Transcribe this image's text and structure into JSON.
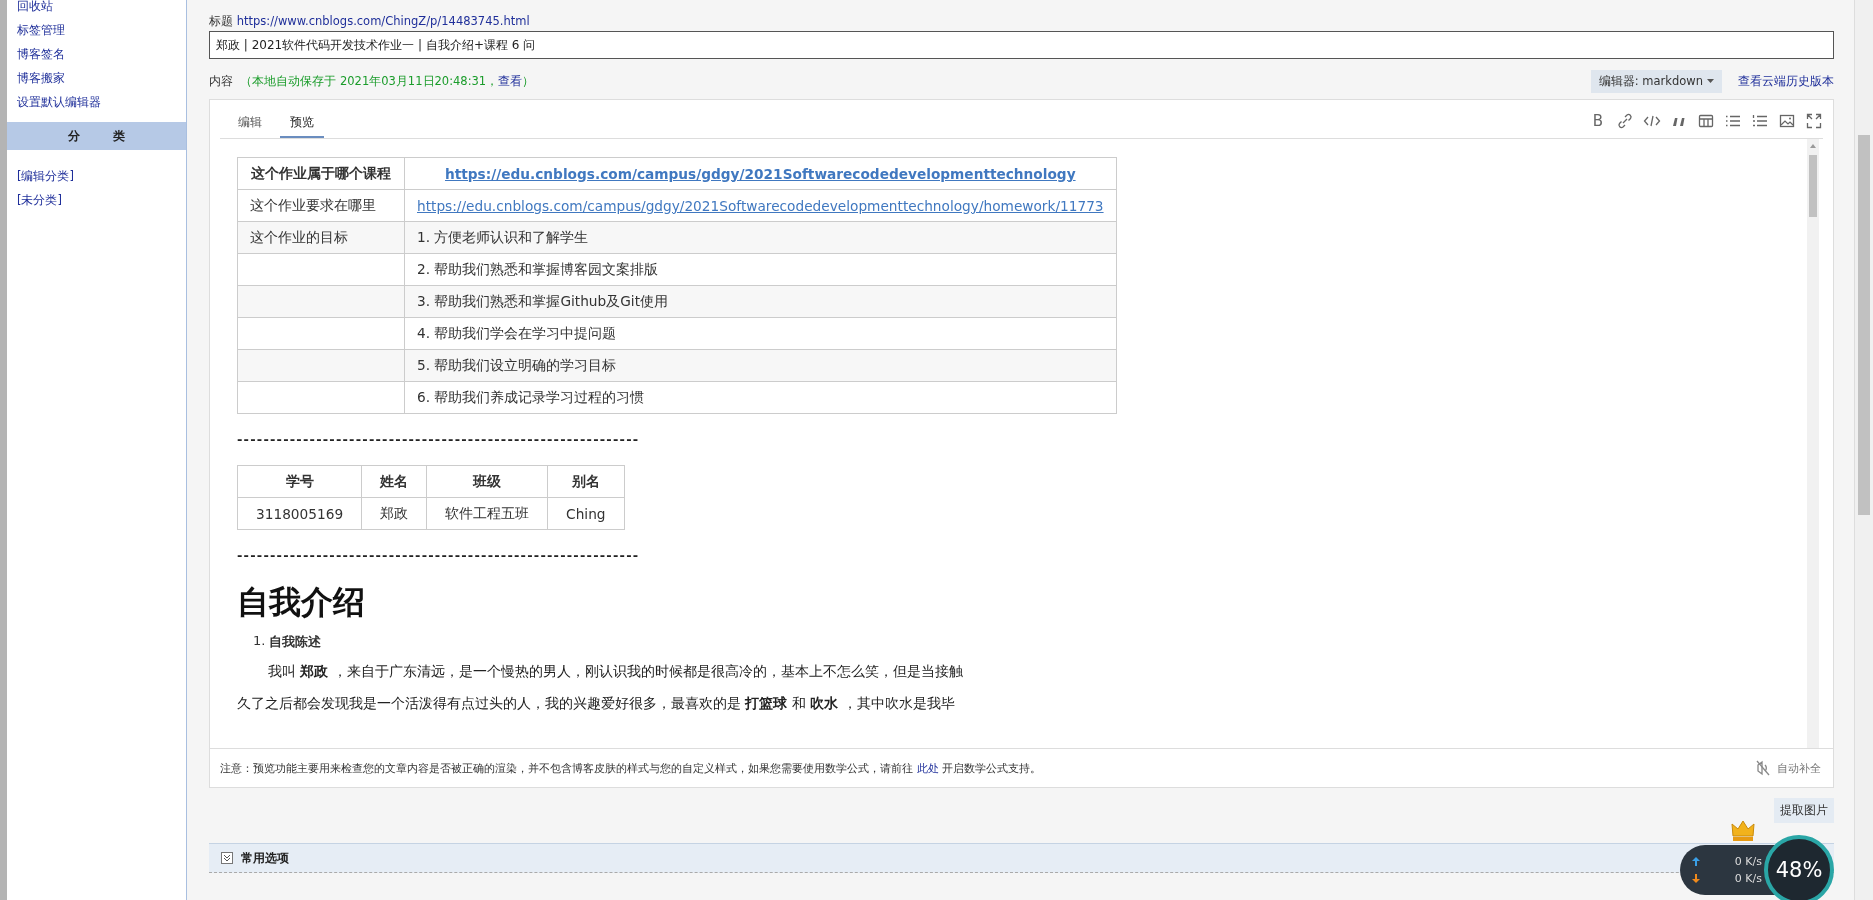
{
  "sidebar": {
    "links": [
      "回收站",
      "标签管理",
      "博客签名",
      "博客搬家",
      "设置默认编辑器"
    ],
    "category_header": "分 类",
    "category_links": [
      "[编辑分类]",
      "[未分类]"
    ]
  },
  "title": {
    "label": "标题",
    "url": "https://www.cnblogs.com/ChingZ/p/14483745.html",
    "value": "郑政 | 2021软件代码开发技术作业一 | 自我介绍+课程 6 问"
  },
  "content": {
    "label": "内容",
    "autosave": "（本地自动保存于 2021年03月11日20:48:31，",
    "view_link": "查看",
    "autosave_end": "）",
    "editor_select": "编辑器: markdown",
    "history_link": "查看云端历史版本"
  },
  "tabs": [
    {
      "label": "编辑",
      "selected": false
    },
    {
      "label": "预览",
      "selected": true
    }
  ],
  "toolbar": {
    "bold_label": "B"
  },
  "preview": {
    "course_table": [
      {
        "kind": "heading-link",
        "label": "这个作业属于哪个课程",
        "value": "https://edu.cnblogs.com/campus/gdgy/2021Softwarecodedevelopmenttechnology"
      },
      {
        "kind": "link",
        "label": "这个作业要求在哪里",
        "value": "https://edu.cnblogs.com/campus/gdgy/2021Softwarecodedevelopmenttechnology/homework/11773"
      },
      {
        "kind": "text",
        "label": "这个作业的目标",
        "value": "1. 方便老师认识和了解学生"
      },
      {
        "kind": "text",
        "value": "2. 帮助我们熟悉和掌握博客园文案排版"
      },
      {
        "kind": "text",
        "value": "3. 帮助我们熟悉和掌握Github及Git使用"
      },
      {
        "kind": "text",
        "value": "4. 帮助我们学会在学习中提问题"
      },
      {
        "kind": "text",
        "value": "5. 帮助我们设立明确的学习目标"
      },
      {
        "kind": "text",
        "value": "6. 帮助我们养成记录学习过程的习惯"
      }
    ],
    "divider_1": "-------------------------------------------------------------",
    "student_table": {
      "columns": [
        "学号",
        "姓名",
        "班级",
        "别名"
      ],
      "rows": [
        [
          "3118005169",
          "郑政",
          "软件工程五班",
          "Ching"
        ]
      ]
    },
    "divider_2": "-------------------------------------------------------------",
    "heading": "自我介绍",
    "list_item": {
      "number": "1.",
      "text": "自我陈述"
    },
    "paragraph": "我叫 **郑政** ，来自于广东清远，是一个慢热的男人，刚认识我的时候都是很高冷的，基本上不怎么笑，但是当接触久了之后都会发现我是一个活泼得有点过头的人，我的兴趣爱好很多，最喜欢的是 **打篮球** 和 **吹水** ，其中吹水是我毕"
  },
  "notice": {
    "text_before": "注意：预览功能主要用来检查您的文章内容是否被正确的渲染，并不包含博客皮肤的样式与您的自定义样式，如果您需要使用数学公式，请前往 ",
    "link": "此处",
    "text_after": " 开启数学公式支持。",
    "autocomplete": "自动补全"
  },
  "extract_button": "提取图片",
  "common_options": {
    "label": "常用选项",
    "expanded": false
  },
  "speed_widget": {
    "upload": "0 K/s",
    "download": "0 K/s",
    "percent": "48%"
  }
}
